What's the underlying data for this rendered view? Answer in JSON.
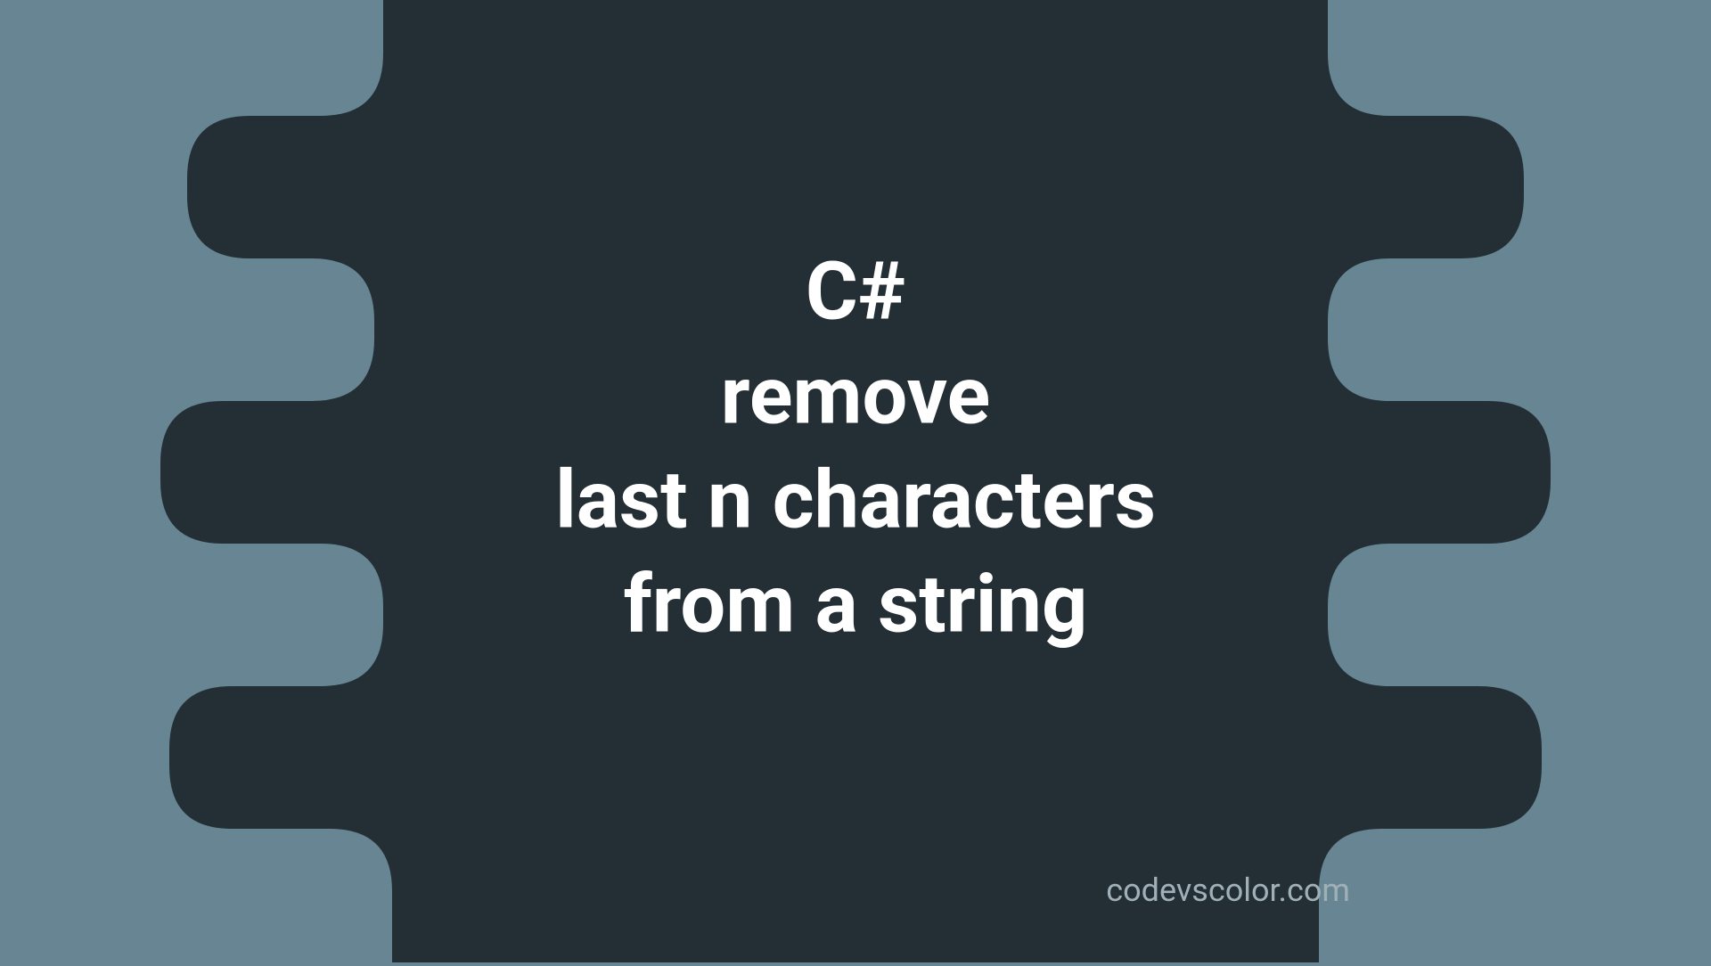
{
  "title": {
    "line1": "C#",
    "line2": "remove",
    "line3": "last n characters",
    "line4": "from a string"
  },
  "watermark": "codevscolor.com",
  "colors": {
    "background": "#678593",
    "blob": "#232f34",
    "text": "#ffffff",
    "watermark": "#a0b0b8"
  }
}
